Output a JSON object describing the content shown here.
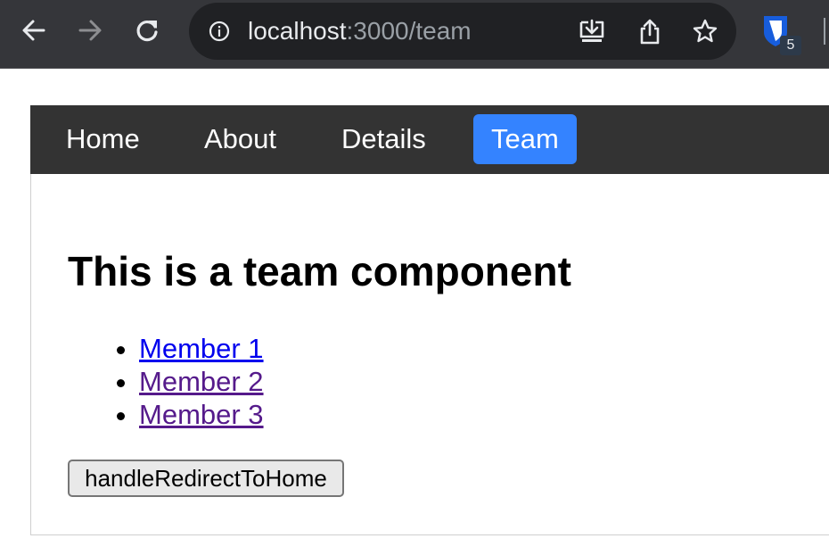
{
  "browser": {
    "url_host": "localhost",
    "url_path": ":3000/team",
    "extension_badge": "5"
  },
  "navbar": {
    "items": [
      {
        "label": "Home",
        "active": false
      },
      {
        "label": "About",
        "active": false
      },
      {
        "label": "Details",
        "active": false
      },
      {
        "label": "Team",
        "active": true
      }
    ],
    "background": "#333333",
    "active_color": "#3483ff"
  },
  "main": {
    "heading": "This is a team component",
    "members": [
      {
        "label": "Member 1",
        "visited": false
      },
      {
        "label": "Member 2",
        "visited": true
      },
      {
        "label": "Member 3",
        "visited": true
      }
    ],
    "button_label": "handleRedirectToHome"
  },
  "icons": {
    "back": "arrow-left-icon",
    "forward": "arrow-right-icon",
    "reload": "reload-icon",
    "info": "info-icon",
    "install": "install-icon",
    "share": "share-icon",
    "star": "star-icon",
    "extension": "password-manager-extension-icon"
  }
}
